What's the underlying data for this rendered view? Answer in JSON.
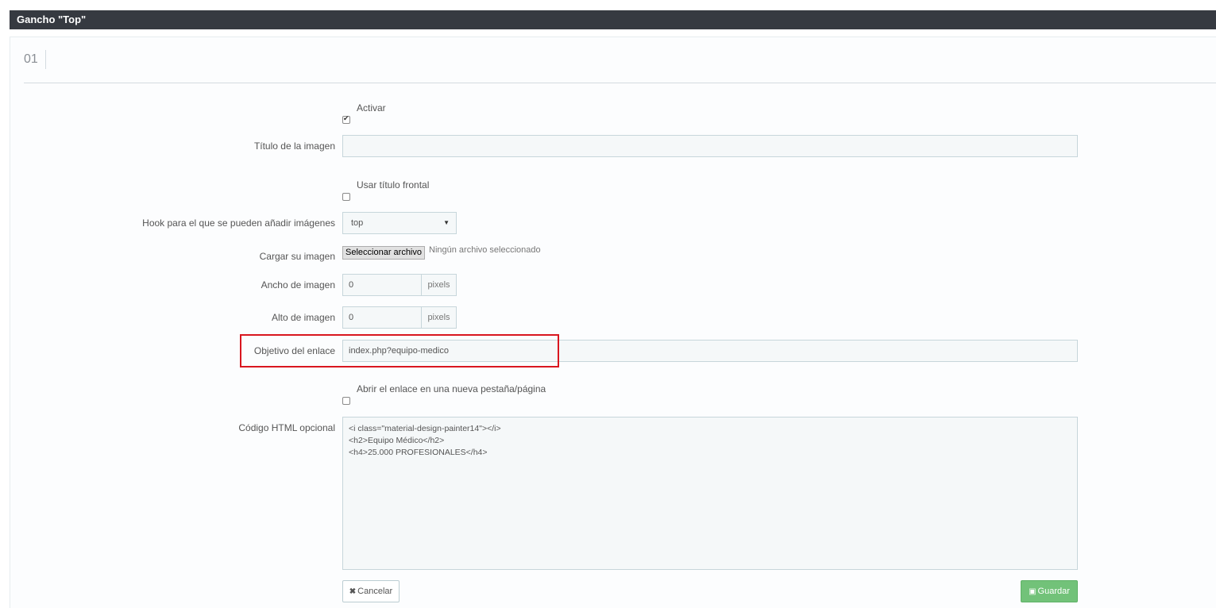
{
  "panel": {
    "title": "Gancho \"Top\"",
    "section_number": "01"
  },
  "form": {
    "activar": {
      "label": "Activar",
      "checked": true
    },
    "titulo_imagen": {
      "label": "Título de la imagen",
      "value": ""
    },
    "usar_titulo_frontal": {
      "label": "Usar título frontal",
      "checked": false
    },
    "hook": {
      "label": "Hook para el que se pueden añadir imágenes",
      "value": "top"
    },
    "cargar_imagen": {
      "label": "Cargar su imagen",
      "button": "Seleccionar archivo",
      "status": "Ningún archivo seleccionado"
    },
    "ancho": {
      "label": "Ancho de imagen",
      "value": "0",
      "unit": "pixels"
    },
    "alto": {
      "label": "Alto de imagen",
      "value": "0",
      "unit": "pixels"
    },
    "objetivo": {
      "label": "Objetivo del enlace",
      "value": "index.php?equipo-medico"
    },
    "nueva_pestana": {
      "label": "Abrir el enlace en una nueva pestaña/página",
      "checked": false
    },
    "codigo_html": {
      "label": "Código HTML opcional",
      "value": "<i class=\"material-design-painter14\"></i>\n<h2>Equipo Médico</h2>\n<h4>25.000 PROFESIONALES</h4>"
    }
  },
  "actions": {
    "cancel_label": "Cancelar",
    "save_label": "Guardar"
  },
  "colors": {
    "header_bg": "#363a41",
    "save_green": "#72c279",
    "highlight_red": "#d9161f"
  }
}
